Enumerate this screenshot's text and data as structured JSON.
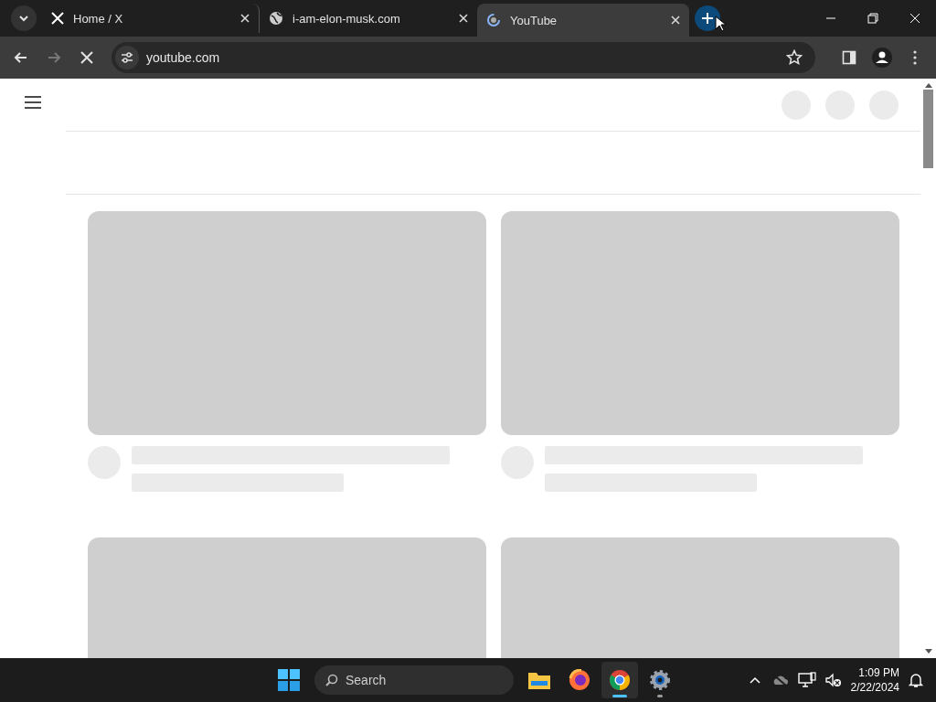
{
  "tabs": [
    {
      "title": "Home / X",
      "kind": "x",
      "selected": false
    },
    {
      "title": "i-am-elon-musk.com",
      "kind": "globe",
      "selected": false
    },
    {
      "title": "YouTube",
      "kind": "loading",
      "selected": true
    }
  ],
  "address_bar": {
    "url": "youtube.com"
  },
  "taskbar": {
    "search": {
      "placeholder": "Search"
    },
    "apps": [
      {
        "kind": "files",
        "selected": false,
        "running": false
      },
      {
        "kind": "firefox",
        "selected": false,
        "running": false
      },
      {
        "kind": "chrome",
        "selected": true,
        "running": true
      },
      {
        "kind": "settings",
        "selected": false,
        "running": true
      }
    ],
    "clock": {
      "time": "1:09 PM",
      "date": "2/22/2024"
    }
  }
}
